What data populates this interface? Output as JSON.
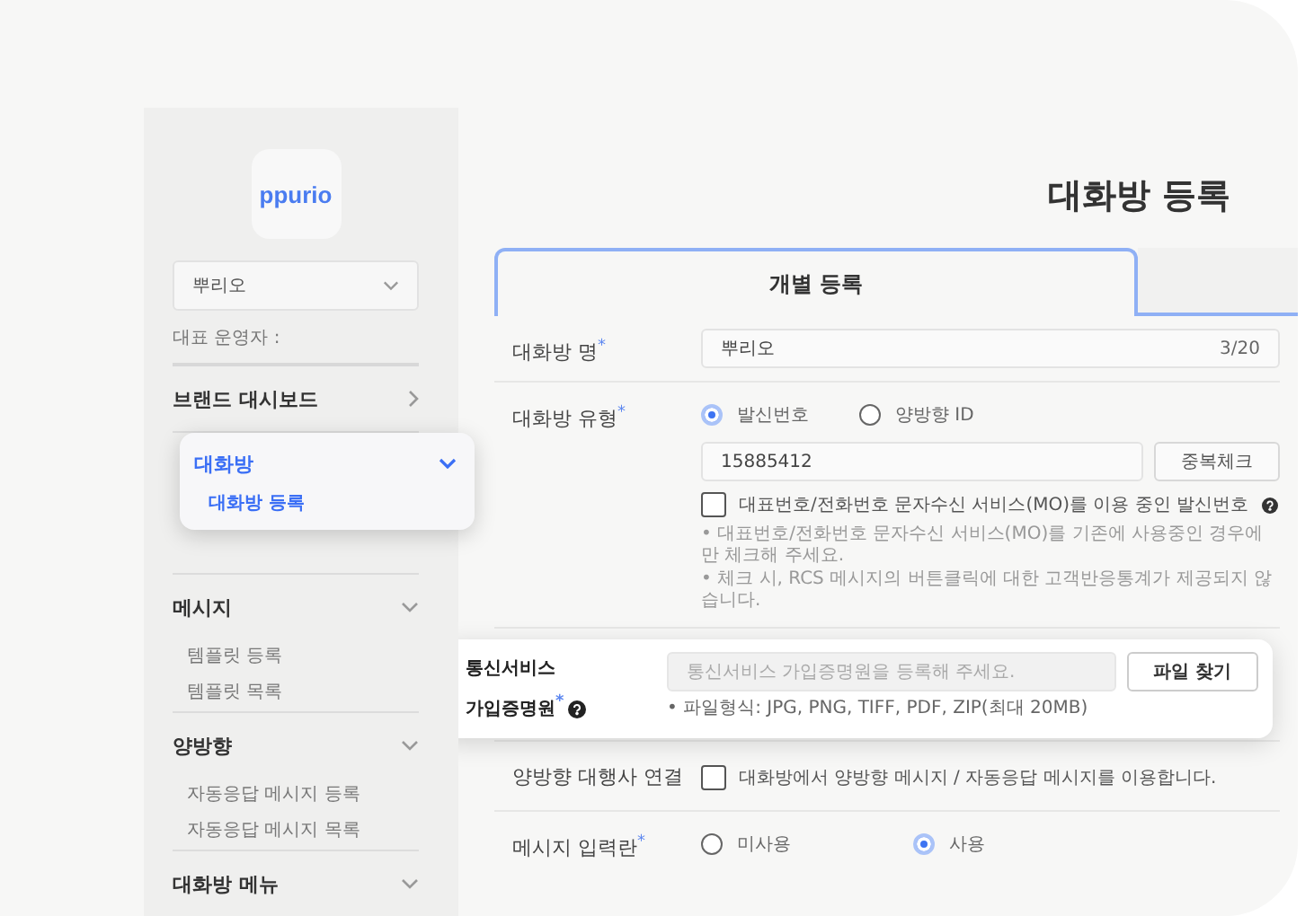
{
  "logo": {
    "text": "ppurio"
  },
  "sidebar": {
    "account_select": {
      "value": "뿌리오"
    },
    "operator_label": "대표 운영자 :",
    "menu": [
      {
        "label": "브랜드 대시보드",
        "kind": "link"
      },
      {
        "label": "메시지",
        "kind": "group",
        "children": [
          {
            "label": "템플릿 등록"
          },
          {
            "label": "템플릿 목록"
          }
        ]
      },
      {
        "label": "양방향",
        "kind": "group",
        "children": [
          {
            "label": "자동응답 메시지 등록"
          },
          {
            "label": "자동응답 메시지 목록"
          }
        ]
      },
      {
        "label": "대화방 메뉴",
        "kind": "group"
      }
    ]
  },
  "menu_popup": {
    "title": "대화방",
    "items": [
      {
        "label": "대화방 등록",
        "selected": true
      }
    ]
  },
  "page_title": "대화방 등록",
  "tabs": [
    {
      "label": "개별 등록",
      "selected": true
    },
    {
      "selected": false
    }
  ],
  "name_row": {
    "label": "대화방 명",
    "required_mark": "*",
    "value": "뿌리오",
    "counter": "3/20"
  },
  "type_row": {
    "label": "대화방 유형",
    "required_mark": "*",
    "options": [
      {
        "label": "발신번호",
        "selected": true
      },
      {
        "label": "양방향 ID",
        "selected": false
      }
    ],
    "number_value": "15885412",
    "check_button": "중복체크",
    "mo_checkbox": {
      "label": "대표번호/전화번호 문자수신 서비스(MO)를 이용 중인 발신번호",
      "checked": false
    },
    "notes": [
      "• 대표번호/전화번호 문자수신 서비스(MO)를 기존에 사용중인 경우에만 체크해 주세요.",
      "• 체크 시, RCS 메시지의 버튼클릭에 대한 고객반응통계가 제공되지 않습니다."
    ]
  },
  "upload_popup": {
    "label_lines": [
      "통신서비스",
      "가입증명원"
    ],
    "required_mark": "*",
    "placeholder": "통신서비스 가입증명원을 등록해 주세요.",
    "button": "파일 찾기",
    "note": "• 파일형식: JPG, PNG, TIFF, PDF, ZIP(최대 20MB)"
  },
  "two_way_row": {
    "label": "양방향 대행사 연결",
    "checkbox": {
      "label": "대화방에서 양방향 메시지 / 자동응답 메시지를 이용합니다.",
      "checked": false
    }
  },
  "message_row": {
    "label": "메시지 입력란",
    "required_mark": "*",
    "options": [
      {
        "label": "미사용",
        "selected": false
      },
      {
        "label": "사용",
        "selected": true
      }
    ]
  }
}
